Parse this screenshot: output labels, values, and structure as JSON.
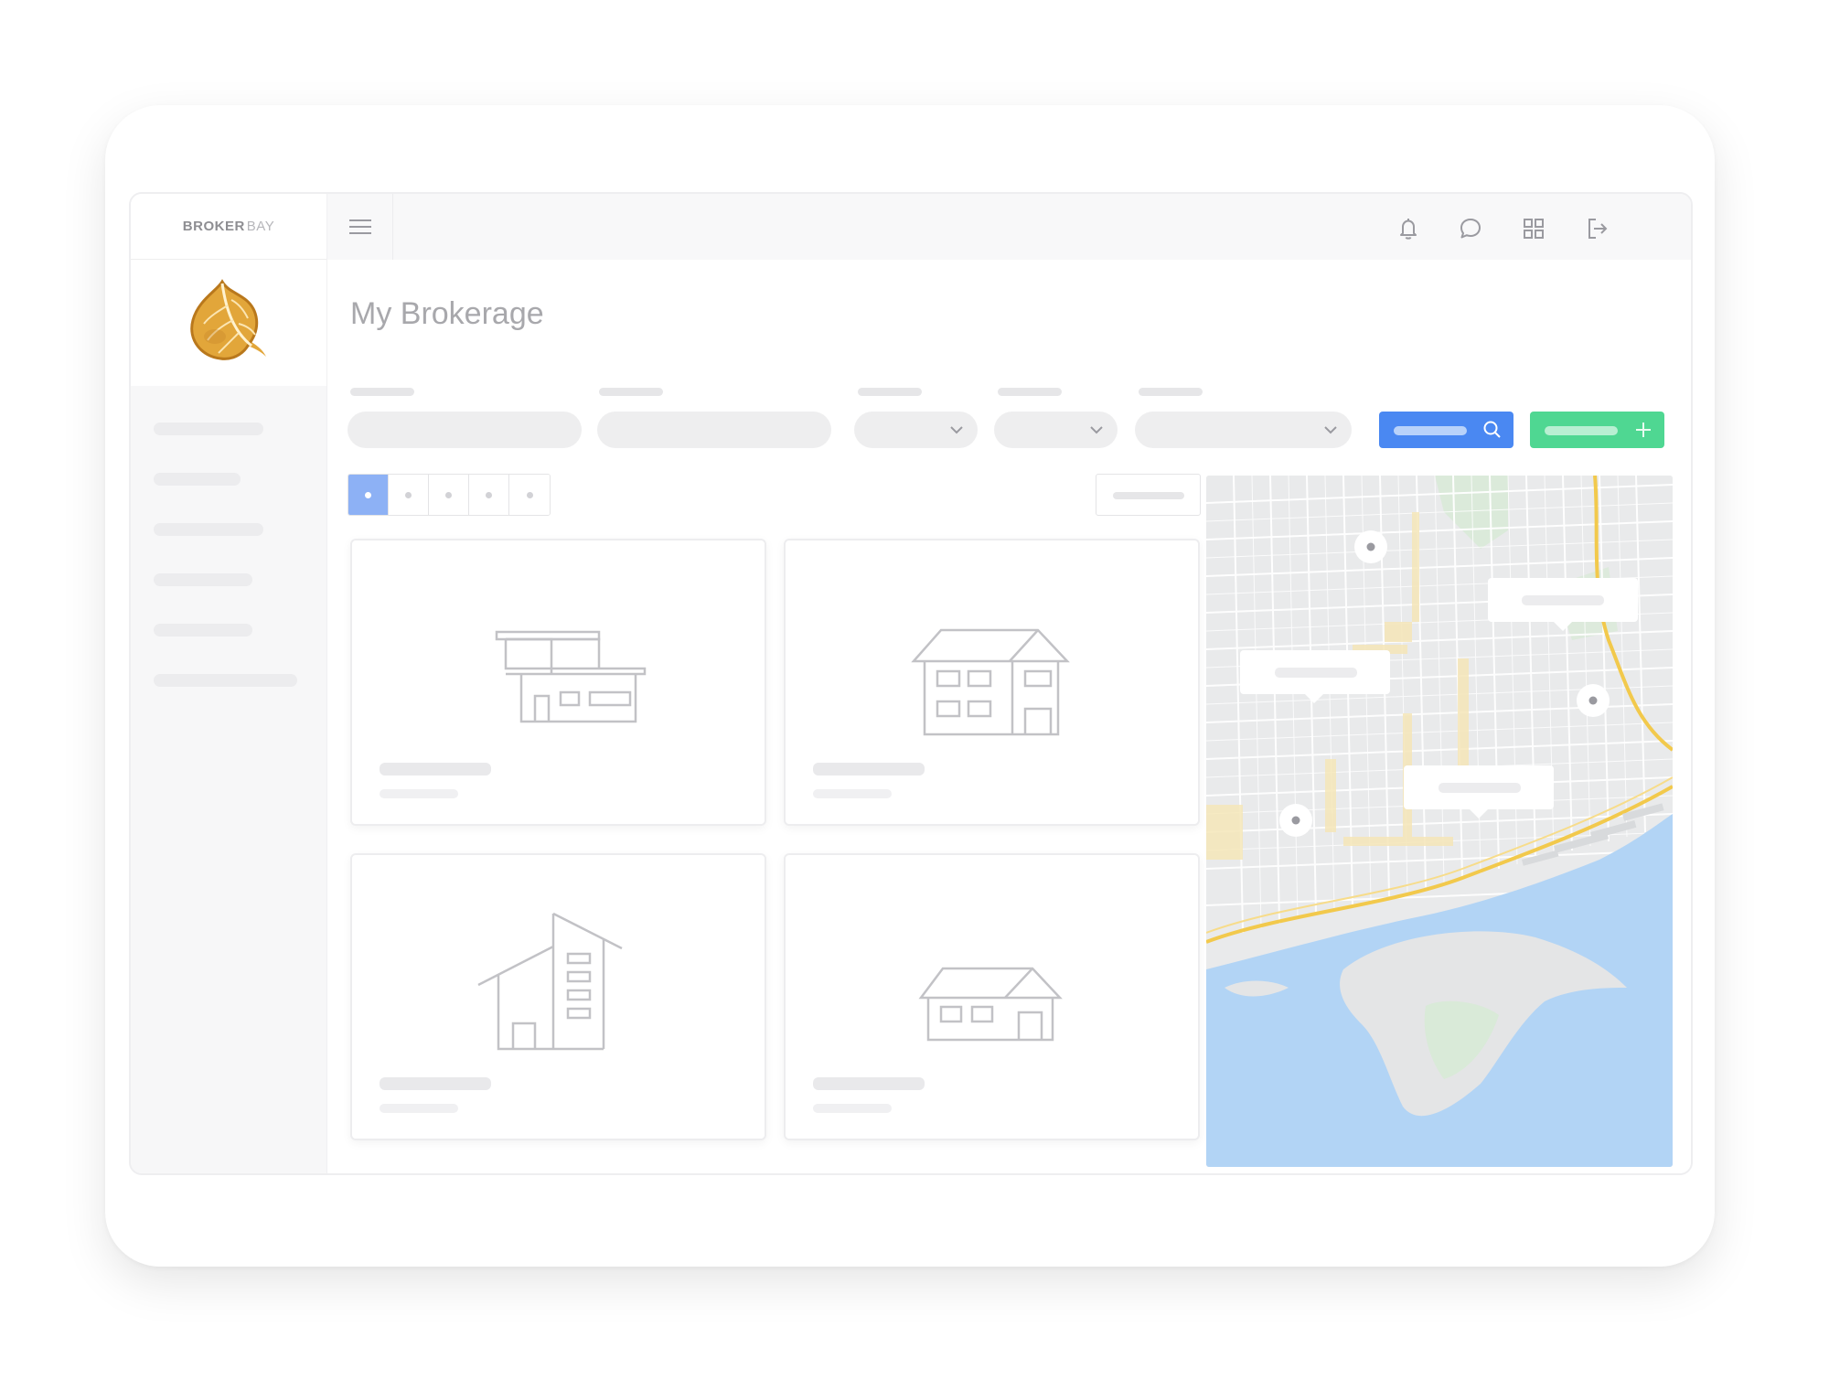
{
  "brand": {
    "name_bold": "BROKER",
    "name_light": "BAY"
  },
  "page": {
    "title": "My Brokerage"
  },
  "topbar": {
    "menu_icon": "hamburger-icon",
    "icons": [
      "bell-icon",
      "chat-icon",
      "grid-icon",
      "logout-icon"
    ]
  },
  "sidebar": {
    "item_count": 6
  },
  "filters": {
    "dropdown_icon": "chevron-down-icon"
  },
  "actions": {
    "search_icon": "search-icon",
    "add_icon": "plus-icon"
  },
  "pagination": {
    "pages": 5,
    "active_page": 1
  },
  "listings": [
    {
      "icon": "modern-house-icon"
    },
    {
      "icon": "two-story-house-icon"
    },
    {
      "icon": "apartment-building-icon"
    },
    {
      "icon": "bungalow-icon"
    }
  ],
  "map": {
    "icon": "map-marker-icon"
  },
  "colors": {
    "primary_blue": "#4a88f2",
    "accent_green": "#4fd792",
    "water": "#b2d4f5",
    "map_land": "#e9eaeb",
    "highway": "#f2c94c",
    "logo_leaf": "#e2a63a"
  }
}
